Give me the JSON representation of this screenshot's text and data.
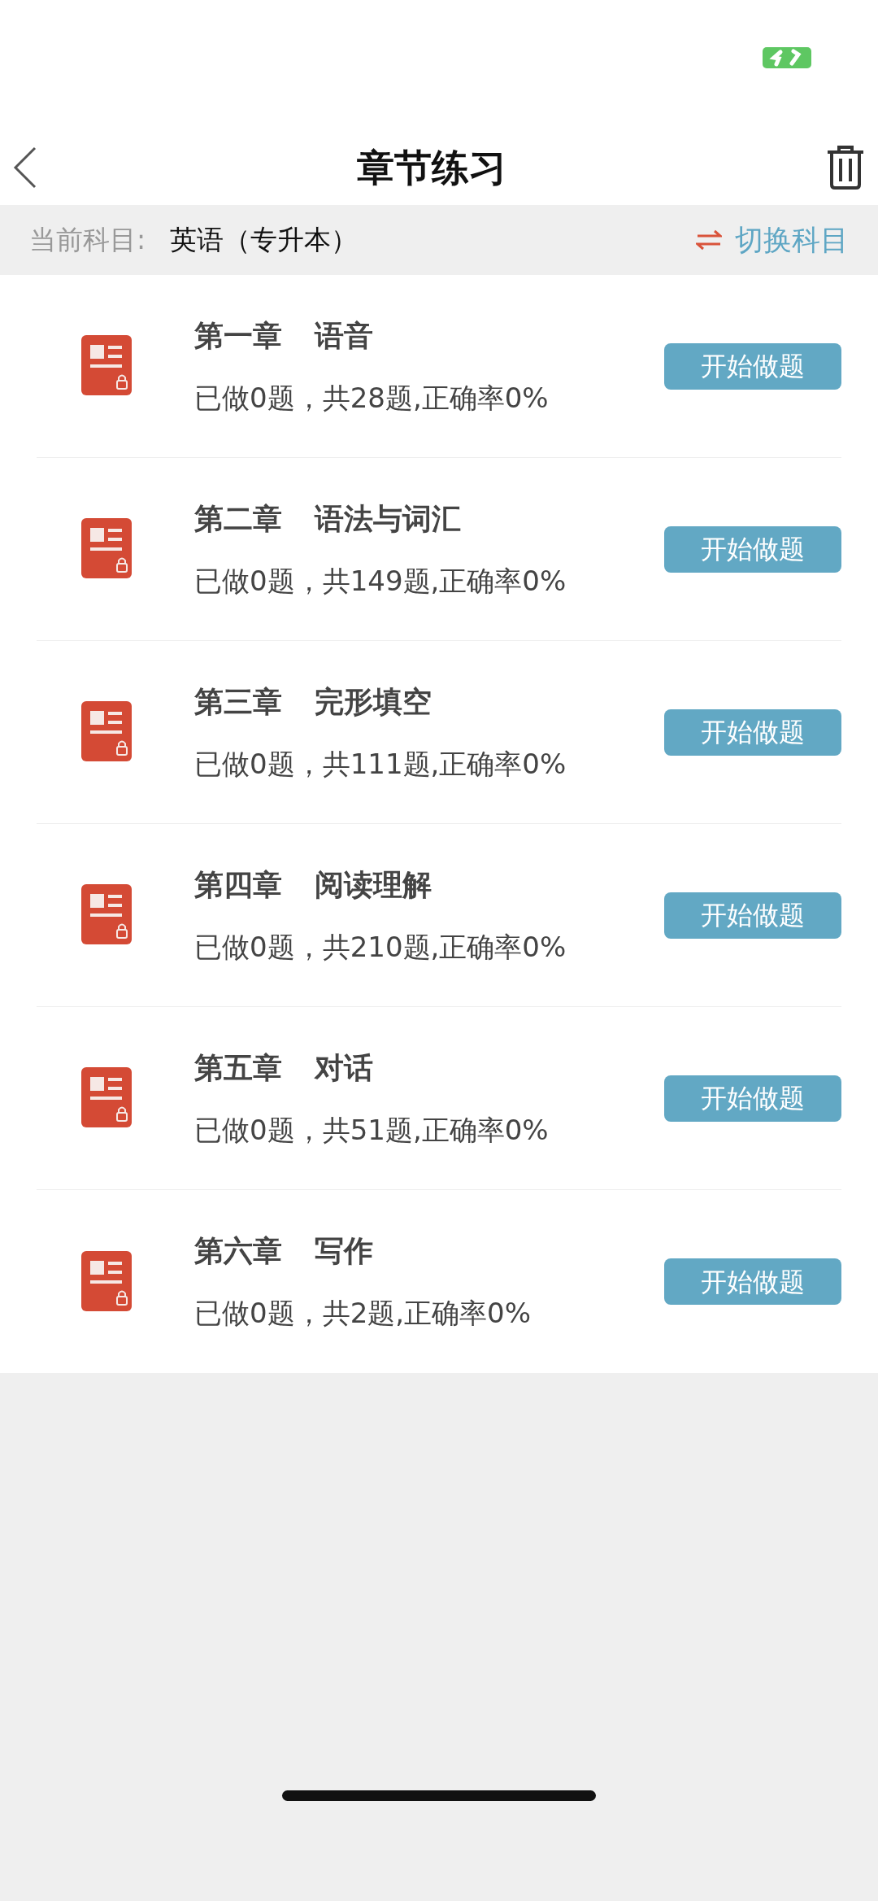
{
  "header": {
    "title": "章节练习"
  },
  "subject_bar": {
    "label": "当前科目:",
    "subject": "英语（专升本）",
    "switch_label": "切换科目"
  },
  "chapters": [
    {
      "chapter": "第一章",
      "name": "语音",
      "stats": "已做0题，共28题,正确率0%",
      "button": "开始做题"
    },
    {
      "chapter": "第二章",
      "name": "语法与词汇",
      "stats": "已做0题，共149题,正确率0%",
      "button": "开始做题"
    },
    {
      "chapter": "第三章",
      "name": "完形填空",
      "stats": "已做0题，共111题,正确率0%",
      "button": "开始做题"
    },
    {
      "chapter": "第四章",
      "name": "阅读理解",
      "stats": "已做0题，共210题,正确率0%",
      "button": "开始做题"
    },
    {
      "chapter": "第五章",
      "name": "对话",
      "stats": "已做0题，共51题,正确率0%",
      "button": "开始做题"
    },
    {
      "chapter": "第六章",
      "name": "写作",
      "stats": "已做0题，共2题,正确率0%",
      "button": "开始做题"
    }
  ]
}
